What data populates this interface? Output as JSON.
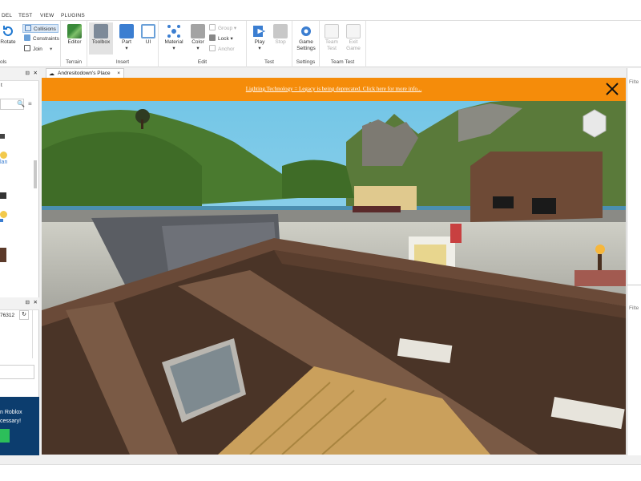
{
  "menubar": {
    "items": [
      "DEL",
      "TEST",
      "VIEW",
      "PLUGINS"
    ]
  },
  "ribbon": {
    "tools": {
      "rotate_label": "Rotate",
      "collisions_label": "Collisions",
      "constraints_label": "Constraints",
      "join_label": "Join",
      "group_label": "ols"
    },
    "terrain": {
      "editor_label": "Editor",
      "group_label": "Terrain"
    },
    "insert": {
      "toolbox_label": "Toolbox",
      "part_label": "Part",
      "ui_label": "UI",
      "group_label": "Insert"
    },
    "edit": {
      "material_label": "Material",
      "color_label": "Color",
      "group_small_label": "Group",
      "lock_label": "Lock",
      "anchor_label": "Anchor",
      "group_label": "Edit"
    },
    "test": {
      "play_label": "Play",
      "stop_label": "Stop",
      "group_label": "Test"
    },
    "settings": {
      "game_settings_label": "Game Settings",
      "group_label": "Settings"
    },
    "team_test": {
      "team_test_label": "Team Test",
      "exit_game_label": "Exit Game",
      "group_label": "Team Test"
    }
  },
  "left_panel": {
    "top_header": "t",
    "item_text_1": "lan",
    "bottom_value": "76312",
    "promo_line1": "n Roblox",
    "promo_line2": "cessary!"
  },
  "document_tab": {
    "title": "Andresitodown's Place",
    "close": "×"
  },
  "banner": {
    "message": "Lighting.Technology = Legacy is being deprecated. Click here for more info...",
    "bg_color": "#f58c0a"
  },
  "right_panel": {
    "filter1": "Filte",
    "filter2": "Filte"
  }
}
